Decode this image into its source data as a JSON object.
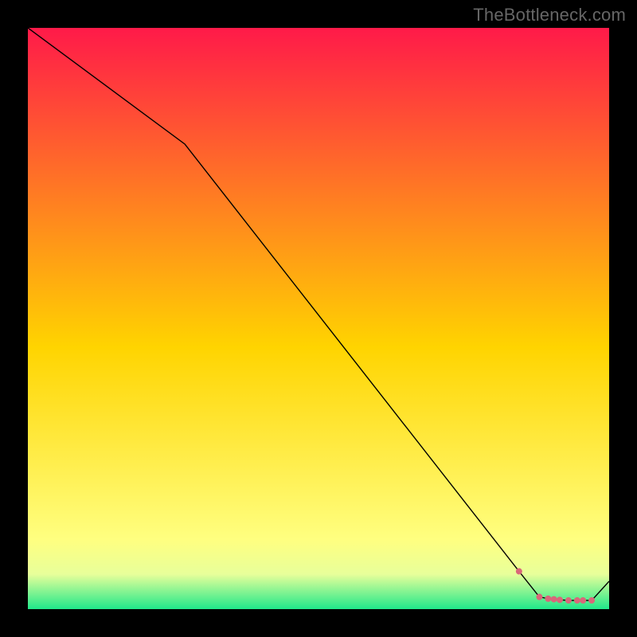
{
  "watermark": "TheBottleneck.com",
  "chart_data": {
    "type": "line",
    "title": "",
    "xlabel": "",
    "ylabel": "",
    "xlim": [
      0,
      100
    ],
    "ylim": [
      0,
      100
    ],
    "x": [
      0,
      27,
      84.5,
      88,
      89.5,
      90.5,
      91.5,
      93,
      94.5,
      95.5,
      97,
      100
    ],
    "y": [
      100,
      80,
      6.5,
      2.1,
      1.8,
      1.7,
      1.6,
      1.5,
      1.5,
      1.5,
      1.5,
      4.8
    ],
    "markers_x": [
      84.5,
      88,
      89.5,
      90.5,
      91.5,
      93,
      94.5,
      95.5,
      97
    ],
    "markers_y": [
      6.5,
      2.1,
      1.8,
      1.7,
      1.6,
      1.5,
      1.5,
      1.5,
      1.5
    ],
    "gradient_top": "#ff1a49",
    "gradient_mid": "#ffd400",
    "gradient_low": "#ffff80",
    "gradient_band_top": "#e8ff9a",
    "gradient_band_bottom": "#20e88a",
    "line_color": "#000000",
    "marker_color": "#d9677a",
    "marker_radius": 4
  }
}
